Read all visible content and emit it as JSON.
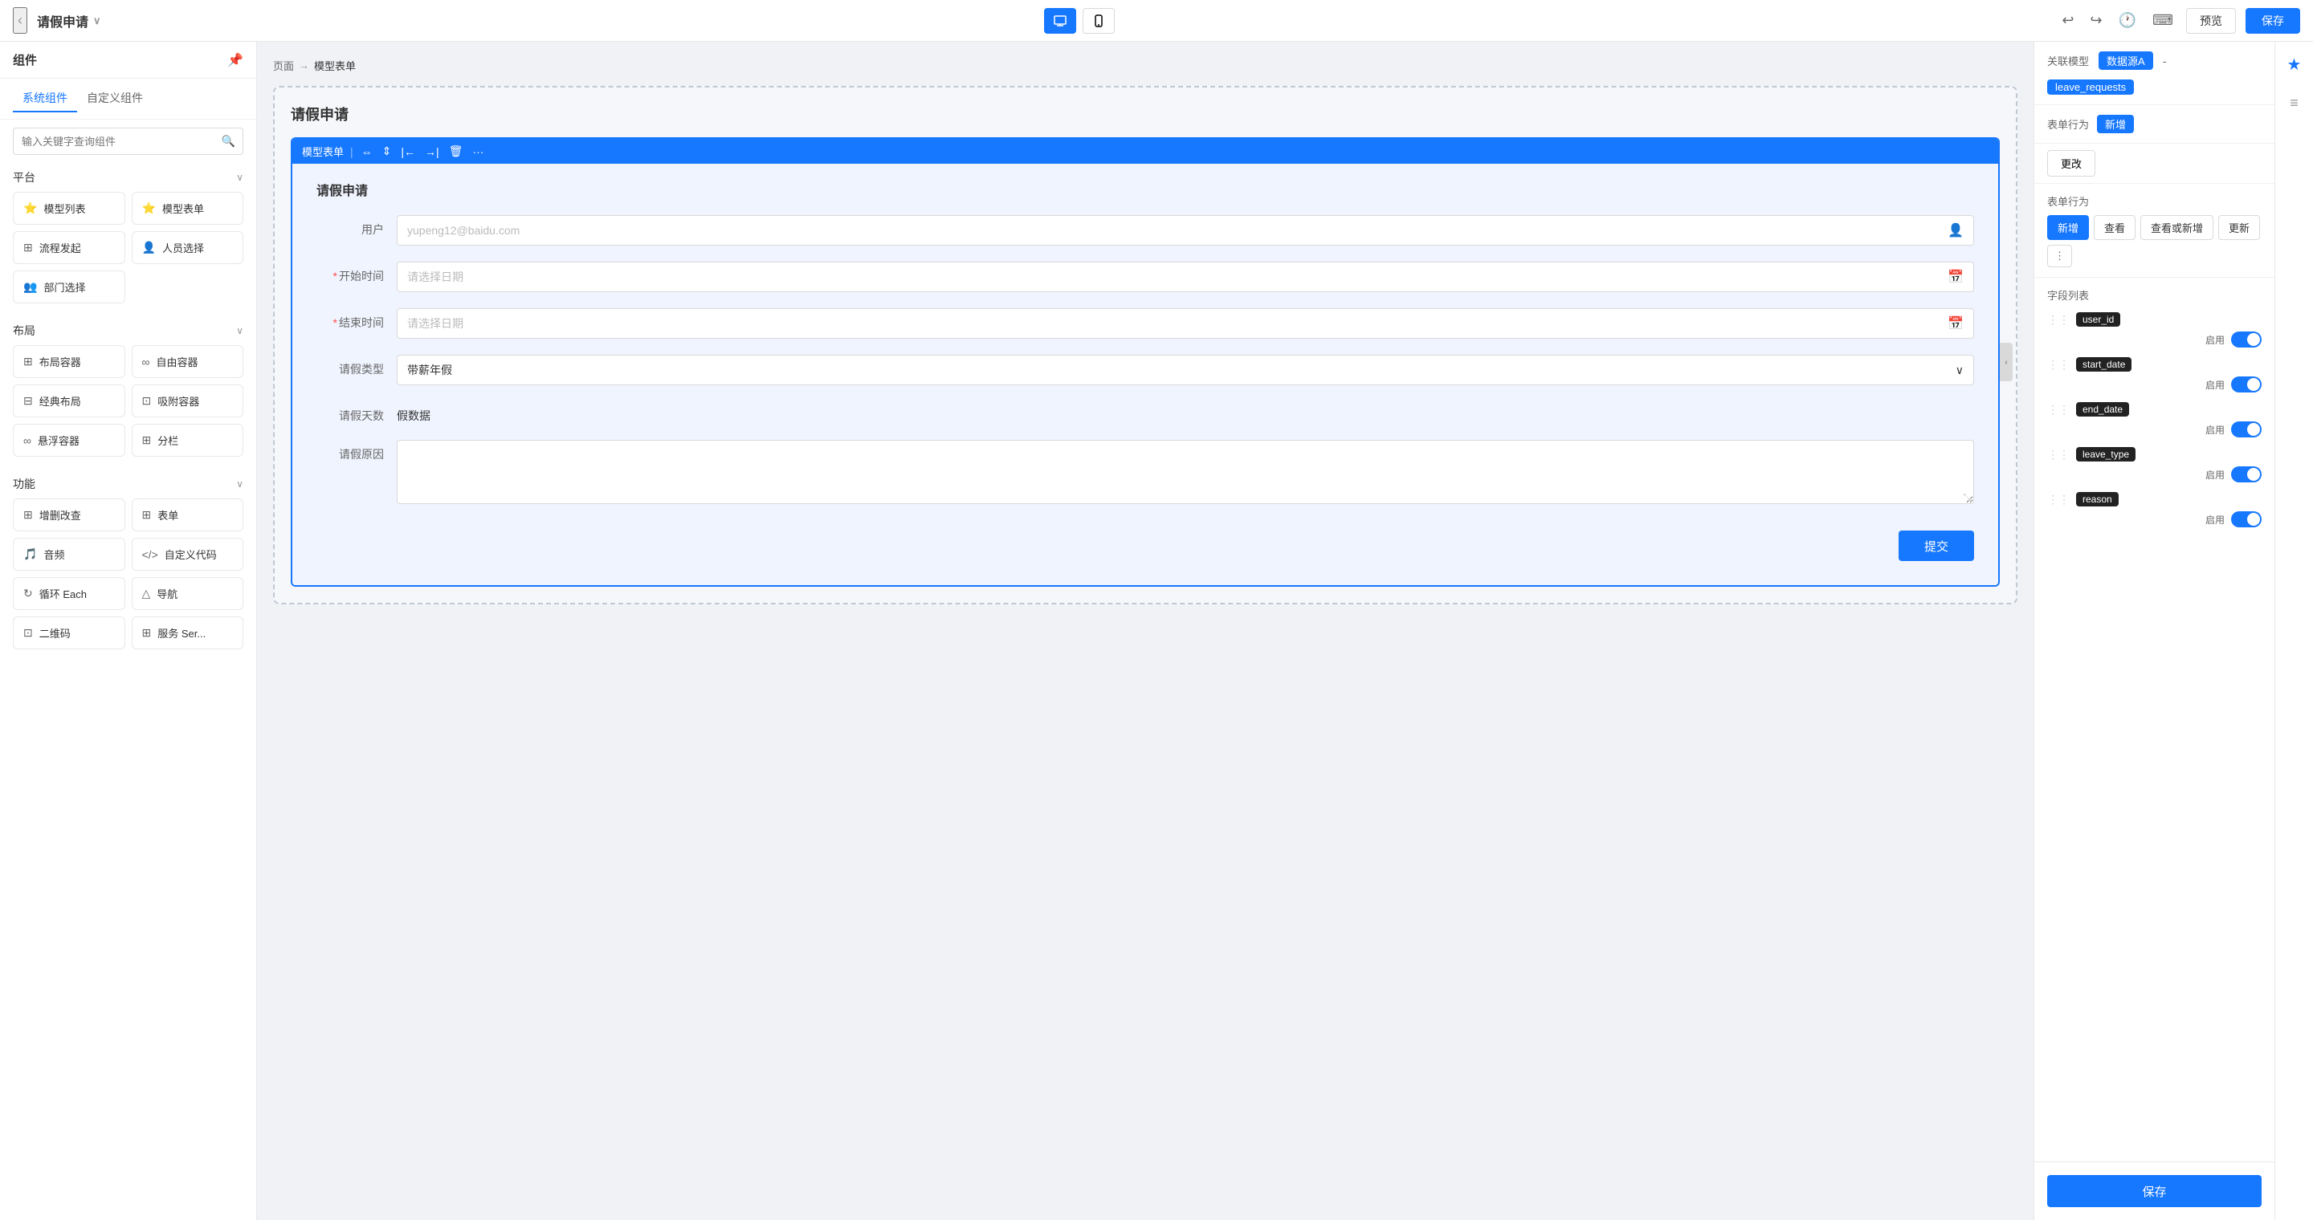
{
  "topbar": {
    "back_icon": "‹",
    "title": "请假申请",
    "title_arrow": "∨",
    "device_desktop": "🖥",
    "device_mobile": "📱",
    "undo_icon": "↩",
    "redo_icon": "↪",
    "history_icon": "🕐",
    "keyboard_icon": "⌨",
    "preview_label": "预览",
    "save_label": "保存"
  },
  "sidebar": {
    "header_title": "组件",
    "pin_icon": "📌",
    "tab_system": "系统组件",
    "tab_custom": "自定义组件",
    "search_placeholder": "输入关键字查询组件",
    "sections": [
      {
        "name": "platform",
        "label": "平台",
        "items": [
          {
            "icon": "⭐",
            "label": "模型列表",
            "icon_color": "yellow"
          },
          {
            "icon": "⭐",
            "label": "模型表单",
            "icon_color": "yellow"
          },
          {
            "icon": "⊞",
            "label": "流程发起"
          },
          {
            "icon": "👤",
            "label": "人员选择"
          },
          {
            "icon": "👥",
            "label": "部门选择"
          }
        ]
      },
      {
        "name": "layout",
        "label": "布局",
        "items": [
          {
            "icon": "⊞",
            "label": "布局容器"
          },
          {
            "icon": "∞",
            "label": "自由容器"
          },
          {
            "icon": "⊟",
            "label": "经典布局"
          },
          {
            "icon": "⊡",
            "label": "吸附容器"
          },
          {
            "icon": "∞",
            "label": "悬浮容器"
          },
          {
            "icon": "⊞",
            "label": "分栏"
          }
        ]
      },
      {
        "name": "function",
        "label": "功能",
        "items": [
          {
            "icon": "⊞",
            "label": "增删改查"
          },
          {
            "icon": "⊞",
            "label": "表单"
          },
          {
            "icon": "🎵",
            "label": "音频"
          },
          {
            "icon": "<>",
            "label": "自定义代码"
          },
          {
            "icon": "↻",
            "label": "循环 Each"
          },
          {
            "icon": "△",
            "label": "导航"
          },
          {
            "icon": "⊡",
            "label": "二维码"
          },
          {
            "icon": "⊞",
            "label": "服务 Ser..."
          }
        ]
      }
    ]
  },
  "breadcrumb": {
    "page": "页面",
    "sep": "→",
    "current": "模型表单"
  },
  "canvas": {
    "form_title": "请假申请",
    "component_label": "模型表单",
    "toolbar_icons": [
      "↔",
      "⇔",
      "←|",
      "|→",
      "🗑",
      "···"
    ],
    "form": {
      "inner_title": "请假申请",
      "fields": [
        {
          "label": "用户",
          "required": false,
          "type": "input",
          "placeholder": "yupeng12@baidu.com",
          "has_icon": true
        },
        {
          "label": "开始时间",
          "required": true,
          "type": "date",
          "placeholder": "请选择日期",
          "has_icon": true
        },
        {
          "label": "结束时间",
          "required": true,
          "type": "date",
          "placeholder": "请选择日期",
          "has_icon": true
        },
        {
          "label": "请假类型",
          "required": false,
          "type": "select",
          "value": "带薪年假"
        },
        {
          "label": "请假天数",
          "required": false,
          "type": "days",
          "value": "假数据"
        },
        {
          "label": "请假原因",
          "required": false,
          "type": "textarea",
          "placeholder": ""
        }
      ],
      "submit_label": "提交"
    }
  },
  "right_panel": {
    "related_model_label": "关联模型",
    "datasource_tag": "数据源A",
    "dash": "-",
    "model_tag": "leave_requests",
    "form_action_label": "表单行为",
    "action_new_tag": "新增",
    "update_label": "更改",
    "action_tabs": [
      {
        "label": "新增",
        "active": true
      },
      {
        "label": "查看",
        "active": false
      },
      {
        "label": "查看或新增",
        "active": false
      },
      {
        "label": "更新",
        "active": false
      },
      {
        "label": "⋮",
        "active": false
      }
    ],
    "fields_title": "字段列表",
    "fields": [
      {
        "name": "user_id",
        "enable_label": "启用",
        "enabled": true
      },
      {
        "name": "start_date",
        "enable_label": "启用",
        "enabled": true
      },
      {
        "name": "end_date",
        "enable_label": "启用",
        "enabled": true
      },
      {
        "name": "leave_type",
        "enable_label": "启用",
        "enabled": true
      },
      {
        "name": "reason",
        "enable_label": "启用",
        "enabled": true
      }
    ],
    "save_label": "保存"
  }
}
